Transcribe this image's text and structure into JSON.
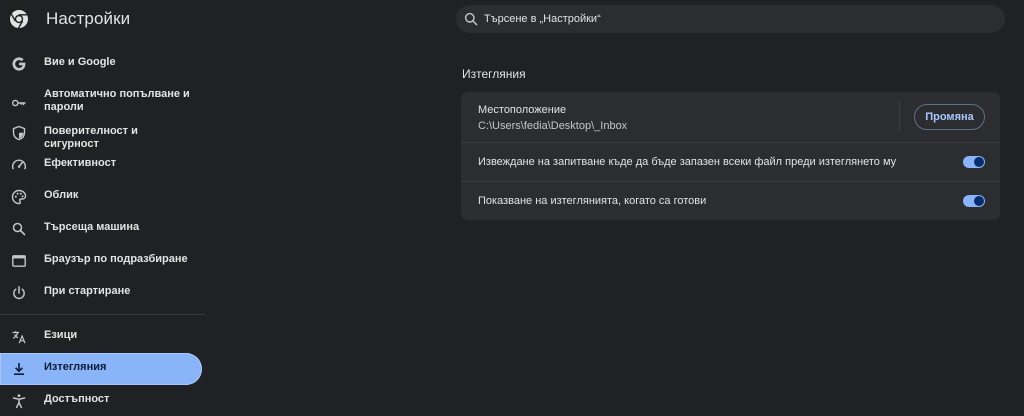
{
  "header": {
    "title": "Настройки",
    "search_placeholder": "Търсене в „Настройки“"
  },
  "sidebar": {
    "items": [
      {
        "label": "Вие и Google",
        "icon": "google-g-icon"
      },
      {
        "label": "Автоматично попълване и пароли",
        "icon": "key-icon"
      },
      {
        "label": "Поверителност и сигурност",
        "icon": "shield-icon"
      },
      {
        "label": "Ефективност",
        "icon": "speedometer-icon"
      },
      {
        "label": "Облик",
        "icon": "palette-icon"
      },
      {
        "label": "Търсеща машина",
        "icon": "search-icon"
      },
      {
        "label": "Браузър по подразбиране",
        "icon": "browser-window-icon"
      },
      {
        "label": "При стартиране",
        "icon": "power-icon"
      },
      {
        "label": "Езици",
        "icon": "translate-icon"
      },
      {
        "label": "Изтегляния",
        "icon": "download-icon",
        "active": true
      },
      {
        "label": "Достъпност",
        "icon": "accessibility-icon"
      }
    ]
  },
  "main": {
    "section_title": "Изтегляния",
    "location_label": "Местоположение",
    "location_path": "C:\\Users\\fedia\\Desktop\\_Inbox",
    "change_button": "Промяна",
    "toggles": [
      {
        "label": "Извеждане на запитване къде да бъде запазен всеки файл преди изтеглянето му",
        "on": true
      },
      {
        "label": "Показване на изтеглянията, когато са готови",
        "on": true
      }
    ]
  },
  "colors": {
    "background": "#202124",
    "card": "#2c2d31",
    "accent": "#8ab4f8",
    "text": "#e3e3e3"
  }
}
